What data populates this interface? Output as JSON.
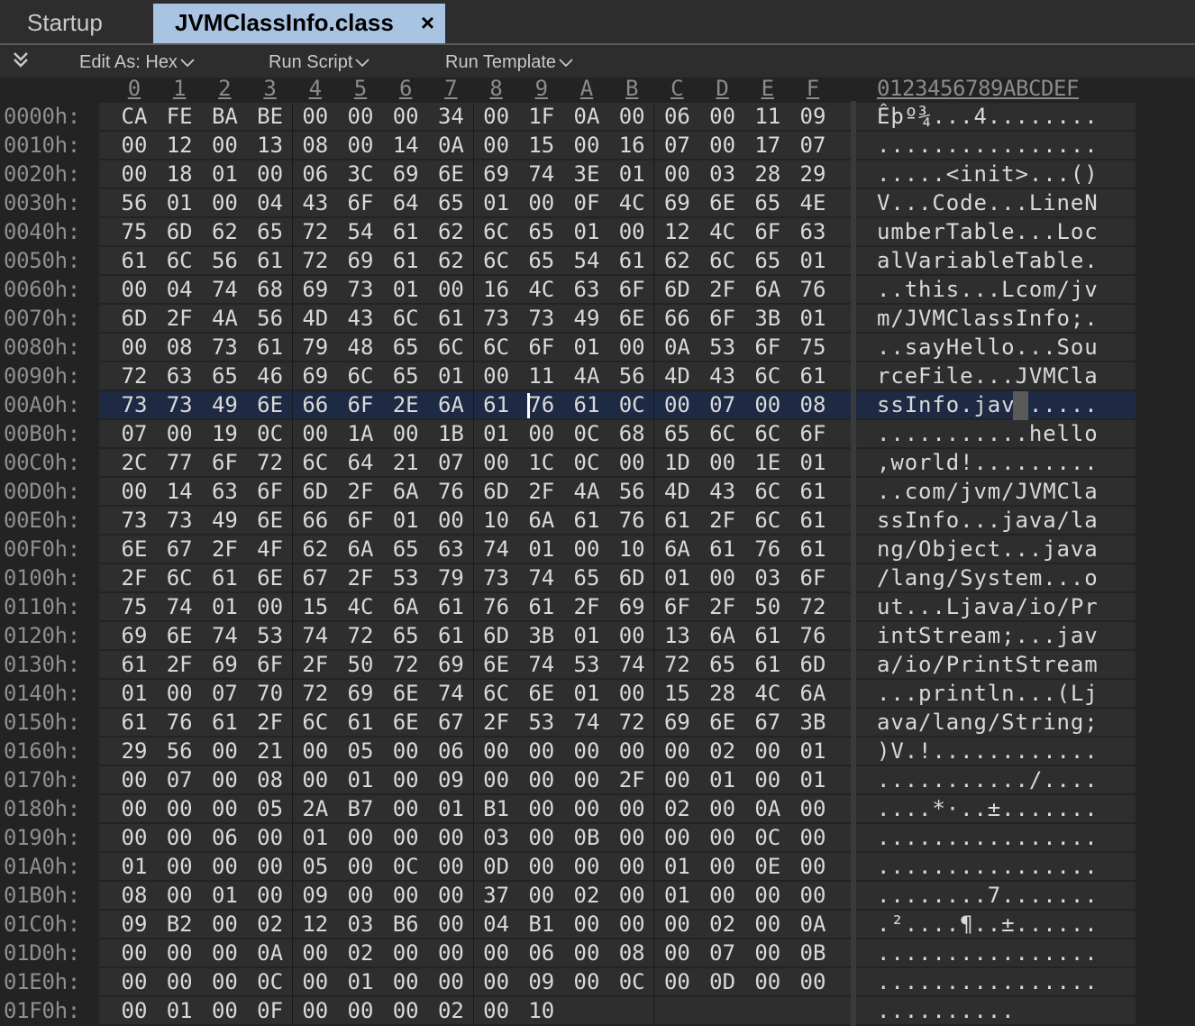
{
  "tabs": {
    "startup": "Startup",
    "active": "JVMClassInfo.class",
    "close": "×"
  },
  "toolbar": {
    "edit_as": "Edit As: Hex",
    "run_script": "Run Script",
    "run_template": "Run Template"
  },
  "header": {
    "columns": [
      "0",
      "1",
      "2",
      "3",
      "4",
      "5",
      "6",
      "7",
      "8",
      "9",
      "A",
      "B",
      "C",
      "D",
      "E",
      "F"
    ],
    "ascii": "0123456789ABCDEF"
  },
  "selected_row": 10,
  "rows": [
    {
      "addr": "0000h:",
      "hex": [
        "CA",
        "FE",
        "BA",
        "BE",
        "00",
        "00",
        "00",
        "34",
        "00",
        "1F",
        "0A",
        "00",
        "06",
        "00",
        "11",
        "09"
      ],
      "ascii": "Êþº¾...4........"
    },
    {
      "addr": "0010h:",
      "hex": [
        "00",
        "12",
        "00",
        "13",
        "08",
        "00",
        "14",
        "0A",
        "00",
        "15",
        "00",
        "16",
        "07",
        "00",
        "17",
        "07"
      ],
      "ascii": "................"
    },
    {
      "addr": "0020h:",
      "hex": [
        "00",
        "18",
        "01",
        "00",
        "06",
        "3C",
        "69",
        "6E",
        "69",
        "74",
        "3E",
        "01",
        "00",
        "03",
        "28",
        "29"
      ],
      "ascii": ".....<init>...()"
    },
    {
      "addr": "0030h:",
      "hex": [
        "56",
        "01",
        "00",
        "04",
        "43",
        "6F",
        "64",
        "65",
        "01",
        "00",
        "0F",
        "4C",
        "69",
        "6E",
        "65",
        "4E"
      ],
      "ascii": "V...Code...LineN"
    },
    {
      "addr": "0040h:",
      "hex": [
        "75",
        "6D",
        "62",
        "65",
        "72",
        "54",
        "61",
        "62",
        "6C",
        "65",
        "01",
        "00",
        "12",
        "4C",
        "6F",
        "63"
      ],
      "ascii": "umberTable...Loc"
    },
    {
      "addr": "0050h:",
      "hex": [
        "61",
        "6C",
        "56",
        "61",
        "72",
        "69",
        "61",
        "62",
        "6C",
        "65",
        "54",
        "61",
        "62",
        "6C",
        "65",
        "01"
      ],
      "ascii": "alVariableTable."
    },
    {
      "addr": "0060h:",
      "hex": [
        "00",
        "04",
        "74",
        "68",
        "69",
        "73",
        "01",
        "00",
        "16",
        "4C",
        "63",
        "6F",
        "6D",
        "2F",
        "6A",
        "76"
      ],
      "ascii": "..this...Lcom/jv"
    },
    {
      "addr": "0070h:",
      "hex": [
        "6D",
        "2F",
        "4A",
        "56",
        "4D",
        "43",
        "6C",
        "61",
        "73",
        "73",
        "49",
        "6E",
        "66",
        "6F",
        "3B",
        "01"
      ],
      "ascii": "m/JVMClassInfo;."
    },
    {
      "addr": "0080h:",
      "hex": [
        "00",
        "08",
        "73",
        "61",
        "79",
        "48",
        "65",
        "6C",
        "6C",
        "6F",
        "01",
        "00",
        "0A",
        "53",
        "6F",
        "75"
      ],
      "ascii": "..sayHello...Sou"
    },
    {
      "addr": "0090h:",
      "hex": [
        "72",
        "63",
        "65",
        "46",
        "69",
        "6C",
        "65",
        "01",
        "00",
        "11",
        "4A",
        "56",
        "4D",
        "43",
        "6C",
        "61"
      ],
      "ascii": "rceFile...JVMCla"
    },
    {
      "addr": "00A0h:",
      "hex": [
        "73",
        "73",
        "49",
        "6E",
        "66",
        "6F",
        "2E",
        "6A",
        "61",
        "76",
        "61",
        "0C",
        "00",
        "07",
        "00",
        "08"
      ],
      "ascii": "ssInfo.java....."
    },
    {
      "addr": "00B0h:",
      "hex": [
        "07",
        "00",
        "19",
        "0C",
        "00",
        "1A",
        "00",
        "1B",
        "01",
        "00",
        "0C",
        "68",
        "65",
        "6C",
        "6C",
        "6F"
      ],
      "ascii": "...........hello"
    },
    {
      "addr": "00C0h:",
      "hex": [
        "2C",
        "77",
        "6F",
        "72",
        "6C",
        "64",
        "21",
        "07",
        "00",
        "1C",
        "0C",
        "00",
        "1D",
        "00",
        "1E",
        "01"
      ],
      "ascii": ",world!........."
    },
    {
      "addr": "00D0h:",
      "hex": [
        "00",
        "14",
        "63",
        "6F",
        "6D",
        "2F",
        "6A",
        "76",
        "6D",
        "2F",
        "4A",
        "56",
        "4D",
        "43",
        "6C",
        "61"
      ],
      "ascii": "..com/jvm/JVMCla"
    },
    {
      "addr": "00E0h:",
      "hex": [
        "73",
        "73",
        "49",
        "6E",
        "66",
        "6F",
        "01",
        "00",
        "10",
        "6A",
        "61",
        "76",
        "61",
        "2F",
        "6C",
        "61"
      ],
      "ascii": "ssInfo...java/la"
    },
    {
      "addr": "00F0h:",
      "hex": [
        "6E",
        "67",
        "2F",
        "4F",
        "62",
        "6A",
        "65",
        "63",
        "74",
        "01",
        "00",
        "10",
        "6A",
        "61",
        "76",
        "61"
      ],
      "ascii": "ng/Object...java"
    },
    {
      "addr": "0100h:",
      "hex": [
        "2F",
        "6C",
        "61",
        "6E",
        "67",
        "2F",
        "53",
        "79",
        "73",
        "74",
        "65",
        "6D",
        "01",
        "00",
        "03",
        "6F"
      ],
      "ascii": "/lang/System...o"
    },
    {
      "addr": "0110h:",
      "hex": [
        "75",
        "74",
        "01",
        "00",
        "15",
        "4C",
        "6A",
        "61",
        "76",
        "61",
        "2F",
        "69",
        "6F",
        "2F",
        "50",
        "72"
      ],
      "ascii": "ut...Ljava/io/Pr"
    },
    {
      "addr": "0120h:",
      "hex": [
        "69",
        "6E",
        "74",
        "53",
        "74",
        "72",
        "65",
        "61",
        "6D",
        "3B",
        "01",
        "00",
        "13",
        "6A",
        "61",
        "76"
      ],
      "ascii": "intStream;...jav"
    },
    {
      "addr": "0130h:",
      "hex": [
        "61",
        "2F",
        "69",
        "6F",
        "2F",
        "50",
        "72",
        "69",
        "6E",
        "74",
        "53",
        "74",
        "72",
        "65",
        "61",
        "6D"
      ],
      "ascii": "a/io/PrintStream"
    },
    {
      "addr": "0140h:",
      "hex": [
        "01",
        "00",
        "07",
        "70",
        "72",
        "69",
        "6E",
        "74",
        "6C",
        "6E",
        "01",
        "00",
        "15",
        "28",
        "4C",
        "6A"
      ],
      "ascii": "...println...(Lj"
    },
    {
      "addr": "0150h:",
      "hex": [
        "61",
        "76",
        "61",
        "2F",
        "6C",
        "61",
        "6E",
        "67",
        "2F",
        "53",
        "74",
        "72",
        "69",
        "6E",
        "67",
        "3B"
      ],
      "ascii": "ava/lang/String;"
    },
    {
      "addr": "0160h:",
      "hex": [
        "29",
        "56",
        "00",
        "21",
        "00",
        "05",
        "00",
        "06",
        "00",
        "00",
        "00",
        "00",
        "00",
        "02",
        "00",
        "01"
      ],
      "ascii": ")V.!............"
    },
    {
      "addr": "0170h:",
      "hex": [
        "00",
        "07",
        "00",
        "08",
        "00",
        "01",
        "00",
        "09",
        "00",
        "00",
        "00",
        "2F",
        "00",
        "01",
        "00",
        "01"
      ],
      "ascii": ".........../...."
    },
    {
      "addr": "0180h:",
      "hex": [
        "00",
        "00",
        "00",
        "05",
        "2A",
        "B7",
        "00",
        "01",
        "B1",
        "00",
        "00",
        "00",
        "02",
        "00",
        "0A",
        "00"
      ],
      "ascii": "....*·..±......."
    },
    {
      "addr": "0190h:",
      "hex": [
        "00",
        "00",
        "06",
        "00",
        "01",
        "00",
        "00",
        "00",
        "03",
        "00",
        "0B",
        "00",
        "00",
        "00",
        "0C",
        "00"
      ],
      "ascii": "................"
    },
    {
      "addr": "01A0h:",
      "hex": [
        "01",
        "00",
        "00",
        "00",
        "05",
        "00",
        "0C",
        "00",
        "0D",
        "00",
        "00",
        "00",
        "01",
        "00",
        "0E",
        "00"
      ],
      "ascii": "................"
    },
    {
      "addr": "01B0h:",
      "hex": [
        "08",
        "00",
        "01",
        "00",
        "09",
        "00",
        "00",
        "00",
        "37",
        "00",
        "02",
        "00",
        "01",
        "00",
        "00",
        "00"
      ],
      "ascii": "........7......."
    },
    {
      "addr": "01C0h:",
      "hex": [
        "09",
        "B2",
        "00",
        "02",
        "12",
        "03",
        "B6",
        "00",
        "04",
        "B1",
        "00",
        "00",
        "00",
        "02",
        "00",
        "0A"
      ],
      "ascii": ".²....¶..±......"
    },
    {
      "addr": "01D0h:",
      "hex": [
        "00",
        "00",
        "00",
        "0A",
        "00",
        "02",
        "00",
        "00",
        "00",
        "06",
        "00",
        "08",
        "00",
        "07",
        "00",
        "0B"
      ],
      "ascii": "................"
    },
    {
      "addr": "01E0h:",
      "hex": [
        "00",
        "00",
        "00",
        "0C",
        "00",
        "01",
        "00",
        "00",
        "00",
        "09",
        "00",
        "0C",
        "00",
        "0D",
        "00",
        "00"
      ],
      "ascii": "................"
    },
    {
      "addr": "01F0h:",
      "hex": [
        "00",
        "01",
        "00",
        "0F",
        "00",
        "00",
        "00",
        "02",
        "00",
        "10"
      ],
      "ascii": ".........."
    }
  ]
}
